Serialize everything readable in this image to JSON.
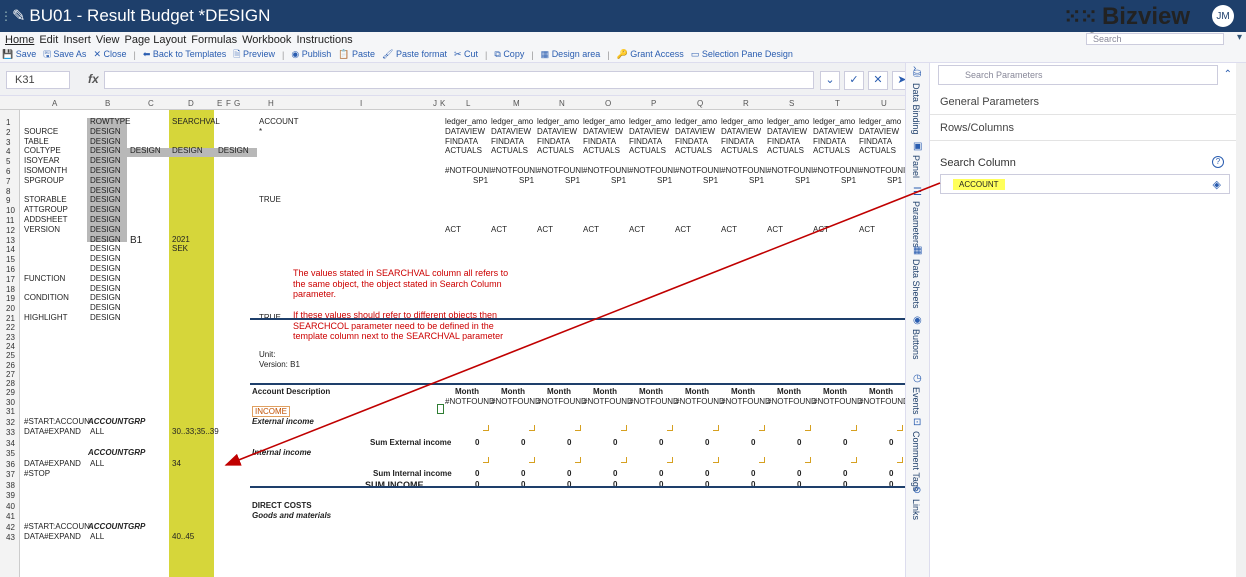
{
  "app": {
    "title": "BU01 - Result Budget *DESIGN",
    "brand": "Bizview",
    "user_initials": "JM"
  },
  "menu": [
    "Home",
    "Edit",
    "Insert",
    "View",
    "Page Layout",
    "Formulas",
    "Workbook",
    "Instructions"
  ],
  "top_search": {
    "placeholder": "Search"
  },
  "ribbon": [
    "Save",
    "Save As",
    "Close",
    "Back to Templates",
    "Preview",
    "Publish",
    "Paste",
    "Paste format",
    "Cut",
    "Copy",
    "Design area",
    "Grant Access",
    "Selection Pane Design"
  ],
  "formula_bar": {
    "cell_ref": "K31",
    "fx": "fx",
    "value": ""
  },
  "sheet": {
    "col_headers": [
      "A",
      "B",
      "C",
      "D",
      "E",
      "F",
      "G",
      "H",
      "I",
      "J",
      "K",
      "L",
      "M",
      "N",
      "O",
      "P",
      "Q",
      "R",
      "S",
      "T",
      "U"
    ],
    "row_numbers": [
      "1",
      "2",
      "3",
      "4",
      "5",
      "6",
      "7",
      "8",
      "9",
      "10",
      "11",
      "12",
      "13",
      "14",
      "15",
      "16",
      "17",
      "18",
      "19",
      "20",
      "21",
      "22",
      "23",
      "24",
      "25",
      "26",
      "27",
      "28",
      "29",
      "30",
      "31",
      "32",
      "33",
      "34",
      "35",
      "36",
      "37",
      "38",
      "39",
      "40",
      "41",
      "42",
      "43"
    ],
    "colA": [
      "SOURCE",
      "TABLE",
      "COLTYPE",
      "ISOYEAR",
      "ISOMONTH",
      "SPGROUP",
      "",
      "STORABLE",
      "ATTGROUP",
      "ADDSHEET",
      "VERSION",
      "",
      "",
      "",
      "",
      "FUNCTION",
      "",
      "CONDITION",
      "",
      "HIGHLIGHT"
    ],
    "rowtype_header": "ROWTYPE",
    "design": "DESIGN",
    "searchval_header": "SEARCHVAL",
    "version_b1": "B1",
    "year": "2021",
    "currency": "SEK",
    "account_header": "ACCOUNT",
    "star": "*",
    "true": "TRUE",
    "unit_label": "Unit:",
    "version_label": "Version: B1",
    "data_cols": {
      "ledger": "ledger_amo",
      "dataview": "DATAVIEW",
      "findata": "FINDATA",
      "actuals": "ACTUALS",
      "notfound": "#NOTFOUNI",
      "sp1": "SP1",
      "act": "ACT",
      "month": "Month",
      "notfound2": "#NOTFOUND",
      "zero": "0"
    },
    "account_desc": "Account  Description",
    "income": "INCOME",
    "external_income": "External income",
    "sum_external": "Sum External income",
    "internal_income": "Internal income",
    "sum_internal": "Sum Internal income",
    "sum_income": "SUM INCOME",
    "direct_costs": "DIRECT COSTS",
    "goods": "Goods and materials",
    "start_accoun": "#START:ACCOUN",
    "accountgrp": "ACCOUNTGRP",
    "data_expand": "DATA#EXPAND",
    "all": "ALL",
    "stop": "#STOP",
    "range1": "30..33;35..39",
    "range2": "34",
    "range3": "40..45",
    "note_lines": [
      "The values stated in SEARCHVAL column all refers to",
      "the same object, the object stated in Search Column",
      "parameter.",
      "",
      "If these values should refer to different objects then",
      "SEARCHCOL parameter need to be defined in the",
      "template column next to the SEARCHVAL parameter"
    ]
  },
  "side_tabs": [
    "Data Binding",
    "Panel",
    "Parameters",
    "Data Sheets",
    "Buttons",
    "Events",
    "Comment Tags",
    "Links"
  ],
  "panel": {
    "search_placeholder": "Search Parameters",
    "sections": [
      "General Parameters",
      "Rows/Columns"
    ],
    "search_column_label": "Search Column",
    "search_column_value": "ACCOUNT"
  },
  "colors": {
    "titlebar": "#1e3f6b",
    "highlight_col": "#d6d63a",
    "note_red": "#cc0000",
    "arrow": "#c00000"
  }
}
